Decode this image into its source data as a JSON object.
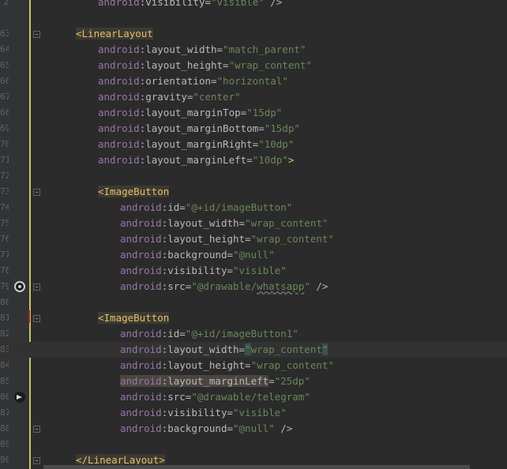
{
  "editor": {
    "lines": [
      {
        "num": "2",
        "segments": [
          {
            "t": "android",
            "c": "ns"
          },
          {
            "t": ":visibility=",
            "c": "attr"
          },
          {
            "t": "\"visible\"",
            "c": "val"
          },
          {
            "t": " />",
            "c": "punct"
          }
        ]
      },
      {
        "num": "",
        "segments": []
      },
      {
        "num": "63",
        "segments": [
          {
            "t": "<LinearLayout",
            "c": "tag-hl"
          }
        ]
      },
      {
        "num": "64",
        "segments": [
          {
            "t": "android",
            "c": "ns"
          },
          {
            "t": ":layout_width=",
            "c": "attr"
          },
          {
            "t": "\"match_parent\"",
            "c": "val"
          }
        ]
      },
      {
        "num": "65",
        "segments": [
          {
            "t": "android",
            "c": "ns"
          },
          {
            "t": ":layout_height=",
            "c": "attr"
          },
          {
            "t": "\"wrap_content\"",
            "c": "val"
          }
        ]
      },
      {
        "num": "66",
        "segments": [
          {
            "t": "android",
            "c": "ns"
          },
          {
            "t": ":orientation=",
            "c": "attr"
          },
          {
            "t": "\"horizontal\"",
            "c": "val"
          }
        ]
      },
      {
        "num": "67",
        "segments": [
          {
            "t": "android",
            "c": "ns"
          },
          {
            "t": ":gravity=",
            "c": "attr"
          },
          {
            "t": "\"center\"",
            "c": "val"
          }
        ]
      },
      {
        "num": "68",
        "segments": [
          {
            "t": "android",
            "c": "ns"
          },
          {
            "t": ":layout_marginTop=",
            "c": "attr"
          },
          {
            "t": "\"15dp\"",
            "c": "val"
          }
        ]
      },
      {
        "num": "69",
        "segments": [
          {
            "t": "android",
            "c": "ns"
          },
          {
            "t": ":layout_marginBottom=",
            "c": "attr"
          },
          {
            "t": "\"15dp\"",
            "c": "val"
          }
        ]
      },
      {
        "num": "70",
        "segments": [
          {
            "t": "android",
            "c": "ns"
          },
          {
            "t": ":layout_marginRight=",
            "c": "attr"
          },
          {
            "t": "\"10dp\"",
            "c": "val"
          }
        ]
      },
      {
        "num": "71",
        "segments": [
          {
            "t": "android",
            "c": "ns"
          },
          {
            "t": ":layout_marginLeft=",
            "c": "attr"
          },
          {
            "t": "\"10dp\"",
            "c": "val"
          },
          {
            "t": ">",
            "c": "tag"
          }
        ]
      },
      {
        "num": "72",
        "segments": []
      },
      {
        "num": "73",
        "segments": [
          {
            "t": "<ImageButton",
            "c": "tag-hl"
          }
        ]
      },
      {
        "num": "74",
        "segments": [
          {
            "t": "android",
            "c": "ns"
          },
          {
            "t": ":id=",
            "c": "attr"
          },
          {
            "t": "\"@+id/imageButton\"",
            "c": "val"
          }
        ]
      },
      {
        "num": "75",
        "segments": [
          {
            "t": "android",
            "c": "ns"
          },
          {
            "t": ":layout_width=",
            "c": "attr"
          },
          {
            "t": "\"wrap_content\"",
            "c": "val"
          }
        ]
      },
      {
        "num": "76",
        "segments": [
          {
            "t": "android",
            "c": "ns"
          },
          {
            "t": ":layout_height=",
            "c": "attr"
          },
          {
            "t": "\"wrap_content\"",
            "c": "val"
          }
        ]
      },
      {
        "num": "77",
        "segments": [
          {
            "t": "android",
            "c": "ns"
          },
          {
            "t": ":background=",
            "c": "attr"
          },
          {
            "t": "\"@null\"",
            "c": "val"
          }
        ]
      },
      {
        "num": "78",
        "segments": [
          {
            "t": "android",
            "c": "ns"
          },
          {
            "t": ":visibility=",
            "c": "attr"
          },
          {
            "t": "\"visible\"",
            "c": "val"
          }
        ]
      },
      {
        "num": "79",
        "segments": [
          {
            "t": "android",
            "c": "ns"
          },
          {
            "t": ":src=",
            "c": "attr"
          },
          {
            "t": "\"@drawable/",
            "c": "val"
          },
          {
            "t": "whatsapp",
            "c": "val squiggle"
          },
          {
            "t": "\"",
            "c": "val"
          },
          {
            "t": " />",
            "c": "punct"
          }
        ]
      },
      {
        "num": "80",
        "segments": []
      },
      {
        "num": "81",
        "segments": [
          {
            "t": "<ImageButton",
            "c": "tag-hl"
          }
        ]
      },
      {
        "num": "82",
        "segments": [
          {
            "t": "android",
            "c": "ns"
          },
          {
            "t": ":id=",
            "c": "attr"
          },
          {
            "t": "\"@+id/imageButton1\"",
            "c": "val"
          }
        ]
      },
      {
        "num": "83",
        "segments": [
          {
            "t": "android",
            "c": "ns"
          },
          {
            "t": ":layout_width=",
            "c": "attr"
          },
          {
            "t": "\"",
            "c": "val quote-hl"
          },
          {
            "t": "wrap_content",
            "c": "val"
          },
          {
            "t": "\"",
            "c": "val quote-hl"
          }
        ]
      },
      {
        "num": "84",
        "segments": [
          {
            "t": "android",
            "c": "ns"
          },
          {
            "t": ":layout_height=",
            "c": "attr"
          },
          {
            "t": "\"wrap_content\"",
            "c": "val"
          }
        ]
      },
      {
        "num": "85",
        "segments": [
          {
            "t": "android",
            "c": "ns attr-hl"
          },
          {
            "t": ":layout_marginLeft",
            "c": "attr attr-hl"
          },
          {
            "t": "=",
            "c": "attr"
          },
          {
            "t": "\"25dp\"",
            "c": "val"
          }
        ]
      },
      {
        "num": "86",
        "segments": [
          {
            "t": "android",
            "c": "ns"
          },
          {
            "t": ":src=",
            "c": "attr"
          },
          {
            "t": "\"@drawable/telegram\"",
            "c": "val"
          }
        ]
      },
      {
        "num": "87",
        "segments": [
          {
            "t": "android",
            "c": "ns"
          },
          {
            "t": ":visibility=",
            "c": "attr"
          },
          {
            "t": "\"visible\"",
            "c": "val"
          }
        ]
      },
      {
        "num": "88",
        "segments": [
          {
            "t": "android",
            "c": "ns"
          },
          {
            "t": ":background=",
            "c": "attr"
          },
          {
            "t": "\"@null\"",
            "c": "val"
          },
          {
            "t": " />",
            "c": "punct"
          }
        ]
      },
      {
        "num": "89",
        "segments": []
      },
      {
        "num": "90",
        "segments": [
          {
            "t": "</LinearLayout>",
            "c": "tag-hl"
          }
        ]
      }
    ],
    "icons": {
      "line_79": "whatsapp-icon",
      "line_86": "telegram-icon"
    },
    "colors": {
      "background": "#2b2b2b",
      "gutter": "#313335",
      "tag": "#e8bf6a",
      "namespace": "#9876aa",
      "attribute": "#bababa",
      "value": "#6a8759"
    }
  }
}
